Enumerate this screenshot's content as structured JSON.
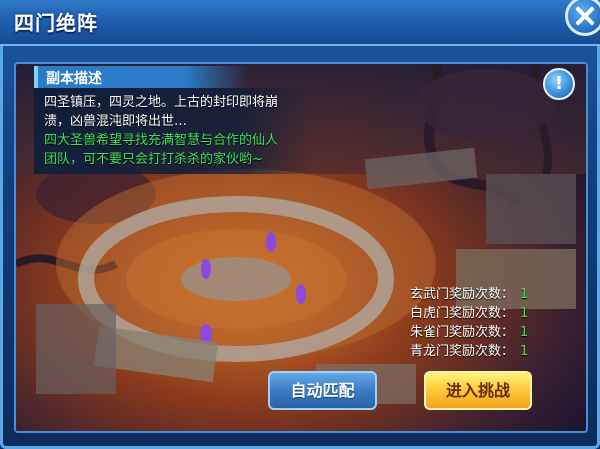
{
  "window": {
    "title": "四门绝阵",
    "close_icon": "close-icon"
  },
  "description": {
    "header": "副本描述",
    "text_line1": "四圣镇压，四灵之地。上古的封印即将崩",
    "text_line2": "溃，凶兽混沌即将出世…",
    "green_line1": "四大圣兽希望寻找充满智慧与合作的仙人",
    "green_line2": "团队，可不要只会打打杀杀的家伙哟~",
    "text_color": "#ffffff",
    "green_color": "#3ee05a"
  },
  "info_button": {
    "label": "!",
    "icon": "info-icon"
  },
  "reward_counts": [
    {
      "label": "玄武门奖励次数：",
      "value": "1"
    },
    {
      "label": "白虎门奖励次数：",
      "value": "1"
    },
    {
      "label": "朱雀门奖励次数：",
      "value": "1"
    },
    {
      "label": "青龙门奖励次数：",
      "value": "1"
    }
  ],
  "buttons": {
    "auto_match": "自动匹配",
    "challenge": "进入挑战"
  },
  "colors": {
    "frame_blue": "#1d5aa3",
    "border_blue": "#5aa8e8",
    "challenge_gold": "#ffc83a",
    "match_blue": "#3a7cc6"
  }
}
